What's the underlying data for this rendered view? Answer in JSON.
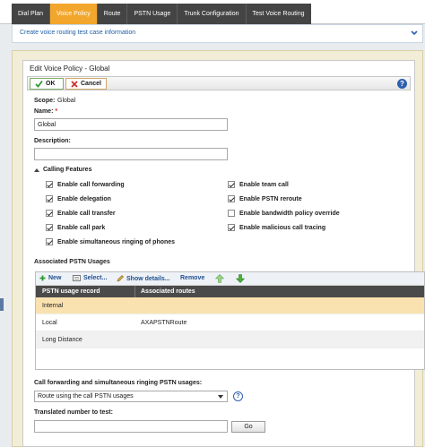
{
  "tabs": [
    "Dial Plan",
    "Voice Policy",
    "Route",
    "PSTN Usage",
    "Trunk Configuration",
    "Test Voice Routing"
  ],
  "active_tab": "Voice Policy",
  "link_bar": {
    "label": "Create voice routing test case information"
  },
  "panel": {
    "title": "Edit Voice Policy - Global",
    "ok_label": "OK",
    "cancel_label": "Cancel",
    "help": "?"
  },
  "scope": {
    "label": "Scope:",
    "value": "Global"
  },
  "name": {
    "label": "Name:",
    "required_mark": "*",
    "value": "Global"
  },
  "description": {
    "label": "Description:",
    "value": ""
  },
  "calling_features": {
    "title": "Calling Features",
    "left": [
      {
        "label": "Enable call forwarding",
        "checked": true
      },
      {
        "label": "Enable delegation",
        "checked": true
      },
      {
        "label": "Enable call transfer",
        "checked": true
      },
      {
        "label": "Enable call park",
        "checked": true
      },
      {
        "label": "Enable simultaneous ringing of phones",
        "checked": true
      }
    ],
    "right": [
      {
        "label": "Enable team call",
        "checked": true
      },
      {
        "label": "Enable PSTN reroute",
        "checked": true
      },
      {
        "label": "Enable bandwidth policy override",
        "checked": false
      },
      {
        "label": "Enable malicious call tracing",
        "checked": true
      }
    ]
  },
  "pstn_usages": {
    "title": "Associated PSTN Usages",
    "buttons": {
      "new": "New",
      "select": "Select...",
      "show_details": "Show details...",
      "remove": "Remove"
    },
    "columns": [
      "PSTN usage record",
      "Associated routes"
    ],
    "rows": [
      {
        "record": "Internal",
        "routes": ""
      },
      {
        "record": "Local",
        "routes": "AXAPSTNRoute"
      },
      {
        "record": "Long Distance",
        "routes": ""
      }
    ],
    "selected_row": 0
  },
  "forwarding_usage": {
    "label": "Call forwarding and simultaneous ringing PSTN usages:",
    "selected": "Route using the call PSTN usages",
    "help": "?"
  },
  "translated_number": {
    "label": "Translated number to test:",
    "value": "",
    "go_label": "Go"
  },
  "colors": {
    "accent": "#f2a62b",
    "tabbar": "#444444",
    "link": "#1f5fa8",
    "selection": "#f9e2b0"
  }
}
